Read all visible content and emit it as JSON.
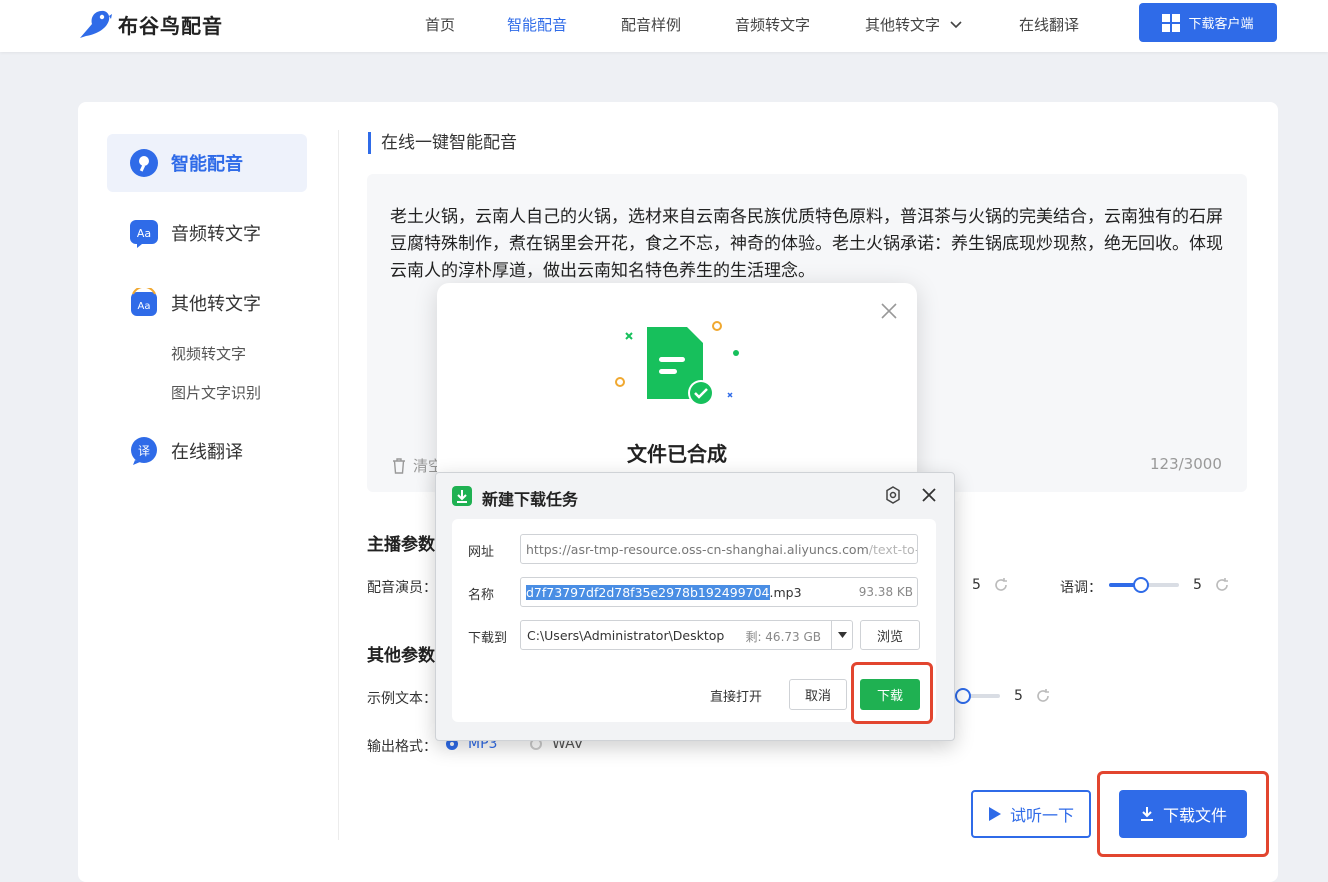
{
  "header": {
    "brand": "布谷鸟配音",
    "nav": [
      "首页",
      "智能配音",
      "配音样例",
      "音频转文字",
      "其他转文字",
      "在线翻译"
    ],
    "active_nav": "智能配音",
    "download_client": "下载客户端",
    "accent": "#2f6be8"
  },
  "sidebar": {
    "items": [
      {
        "label": "智能配音",
        "icon": "voice-icon",
        "active": true
      },
      {
        "label": "音频转文字",
        "icon": "aa-text-icon"
      },
      {
        "label": "其他转文字",
        "icon": "aa-convert-icon"
      },
      {
        "label": "在线翻译",
        "icon": "translate-icon"
      }
    ],
    "sub_items": [
      "视频转文字",
      "图片文字识别"
    ]
  },
  "main": {
    "section_title": "在线一键智能配音",
    "text": "老土火锅，云南人自己的火锅，选材来自云南各民族优质特色原料，普洱茶与火锅的完美结合，云南独有的石屏豆腐特殊制作，煮在锅里会开花，食之不忘，神奇的体验。老土火锅承诺：养生锅底现炒现熬，绝无回收。体现云南人的淳朴厚道，做出云南知名特色养生的生活理念。",
    "clear_label": "清空",
    "counter": "123/3000",
    "anchor_params_title": "主播参数",
    "voice_actor_label": "配音演员：",
    "speed_value": "5",
    "pitch_label": "语调：",
    "pitch_value": "5",
    "pitch_level": 0.5,
    "other_params_title": "其他参数",
    "sample_text_label": "示例文本：",
    "sample_value": "5",
    "output_format_label": "输出格式：",
    "formats": [
      "MP3",
      "WAV"
    ],
    "selected_format": "MP3",
    "try_listen": "试听一下",
    "download_file": "下载文件"
  },
  "done_modal": {
    "title": "文件已合成"
  },
  "download_dialog": {
    "title": "新建下载任务",
    "url_label": "网址",
    "url_visible": "https://asr-tmp-resource.oss-cn-shanghai.aliyuncs.com",
    "url_tail": "/text-to-voic",
    "name_label": "名称",
    "name_selected": "d7f73797df2d78f35e2978b192499704",
    "name_ext": ".mp3",
    "file_size": "93.38 KB",
    "save_to_label": "下载到",
    "save_path": "C:\\Users\\Administrator\\Desktop",
    "free_space": "剩: 46.73 GB",
    "browse": "浏览",
    "open_directly": "直接打开",
    "cancel": "取消",
    "download": "下载",
    "download_color": "#1fb152"
  }
}
